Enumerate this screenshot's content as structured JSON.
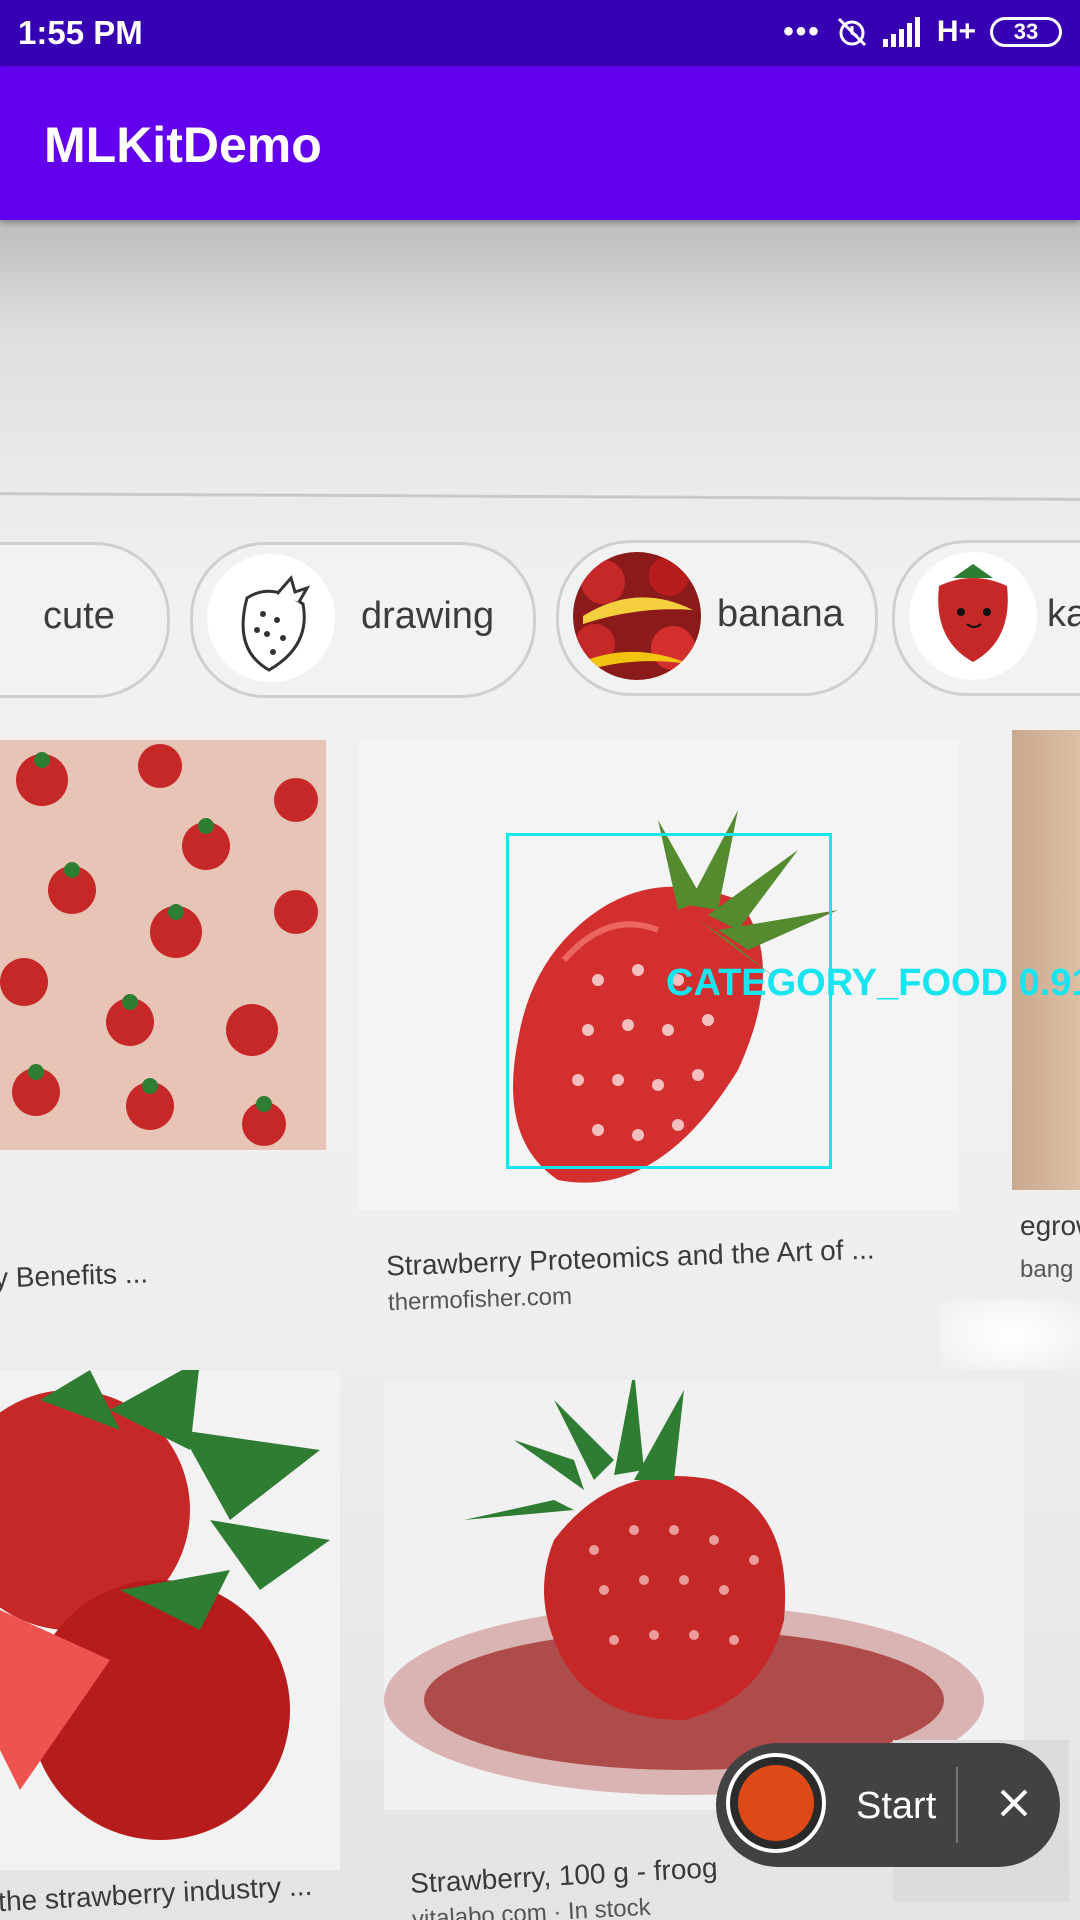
{
  "status_bar": {
    "time": "1:55 PM",
    "more": "•••",
    "network": "H+",
    "battery": "33",
    "icons": [
      "more-dots-icon",
      "alarm-off-icon",
      "signal-icon"
    ]
  },
  "app_bar": {
    "title": "MLKitDemo"
  },
  "chips": [
    {
      "label": "cute"
    },
    {
      "label": "drawing"
    },
    {
      "label": "banana"
    },
    {
      "label": "ka"
    }
  ],
  "results": [
    {
      "caption": "y Benefits ..."
    },
    {
      "caption": "Strawberry Proteomics and the Art of ...",
      "source": "thermofisher.com"
    },
    {
      "caption": "egrow",
      "source": "bang"
    },
    {
      "caption": "the strawberry industry ..."
    },
    {
      "caption": "Strawberry, 100 g - froog",
      "source": "vitalabo.com · In stock"
    }
  ],
  "detection": {
    "label": "CATEGORY_FOOD",
    "confidence": "0.91",
    "color": "#16e4ee"
  },
  "recorder": {
    "start_label": "Start",
    "record_color": "#de4a17",
    "icons": [
      "record-icon",
      "close-icon"
    ]
  }
}
